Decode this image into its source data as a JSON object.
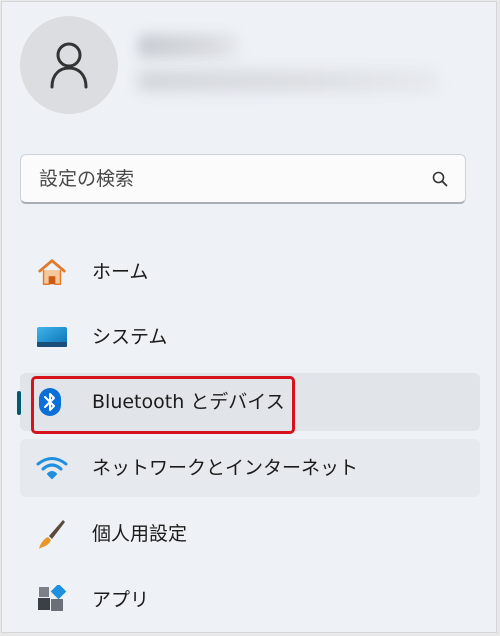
{
  "search": {
    "placeholder": "設定の検索"
  },
  "nav": {
    "items": [
      {
        "label": "ホーム",
        "icon": "home-icon"
      },
      {
        "label": "システム",
        "icon": "system-icon"
      },
      {
        "label": "Bluetooth とデバイス",
        "icon": "bluetooth-icon"
      },
      {
        "label": "ネットワークとインターネット",
        "icon": "wifi-icon"
      },
      {
        "label": "個人用設定",
        "icon": "brush-icon"
      },
      {
        "label": "アプリ",
        "icon": "apps-icon"
      }
    ],
    "selected_index": 2
  },
  "colors": {
    "accent": "#005a70",
    "highlight_border": "#d6121c",
    "bluetooth_blue": "#0a6fd6"
  }
}
